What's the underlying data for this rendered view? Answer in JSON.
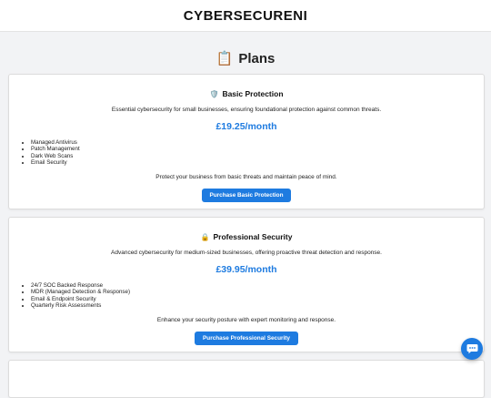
{
  "header": {
    "brand": "CYBERSECURENI"
  },
  "page": {
    "title": "Plans",
    "title_icon": "clipboard-icon"
  },
  "plans": [
    {
      "icon": "shield-icon",
      "name": "Basic Protection",
      "description": "Essential cybersecurity for small businesses, ensuring foundational protection against common threats.",
      "price": "£19.25/month",
      "features": [
        "Managed Antivirus",
        "Patch Management",
        "Dark Web Scans",
        "Email Security"
      ],
      "tagline": "Protect your business from basic threats and maintain peace of mind.",
      "button_label": "Purchase Basic Protection"
    },
    {
      "icon": "lock-icon",
      "name": "Professional Security",
      "description": "Advanced cybersecurity for medium-sized businesses, offering proactive threat detection and response.",
      "price": "£39.95/month",
      "features": [
        "24/7 SOC Backed Response",
        "MDR (Managed Detection & Response)",
        "Email & Endpoint Security",
        "Quarterly Risk Assessments"
      ],
      "tagline": "Enhance your security posture with expert monitoring and response.",
      "button_label": "Purchase Professional Security"
    }
  ],
  "chat": {
    "icon": "chat-bubble-icon"
  },
  "colors": {
    "accent": "#1e7be0",
    "background": "#f2f3f5"
  }
}
